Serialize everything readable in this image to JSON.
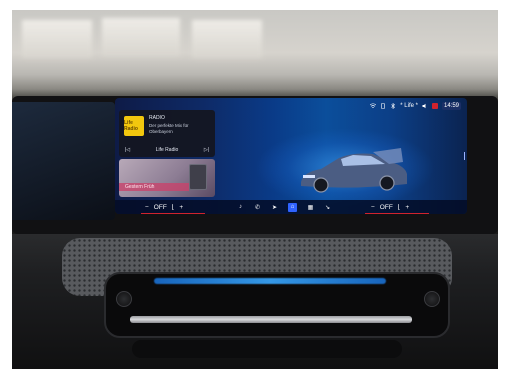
{
  "screen": {
    "status": {
      "life": "* Life *",
      "time": "14:59"
    },
    "radio_widget": {
      "label": "RADIO",
      "station_line": "Der perfekte Mix für Oberbayern",
      "station_name": "Life Radio",
      "logo_text": "Life Radio",
      "prev_icon": "skip-back-icon",
      "next_icon": "skip-forward-icon"
    },
    "apps_widget": {
      "label": "Gestern Früh"
    },
    "climate_left": {
      "minus": "−",
      "value": "OFF",
      "plus": "+"
    },
    "climate_right": {
      "minus": "−",
      "value": "OFF",
      "plus": "+"
    },
    "nav_icons": [
      "music-note-icon",
      "phone-icon",
      "navigation-icon",
      "home-icon",
      "apps-icon",
      "car-icon"
    ],
    "colors": {
      "accent_blue": "#2f63ff",
      "climate_red": "#d0232e",
      "radio_logo": "#f2c70e"
    }
  }
}
